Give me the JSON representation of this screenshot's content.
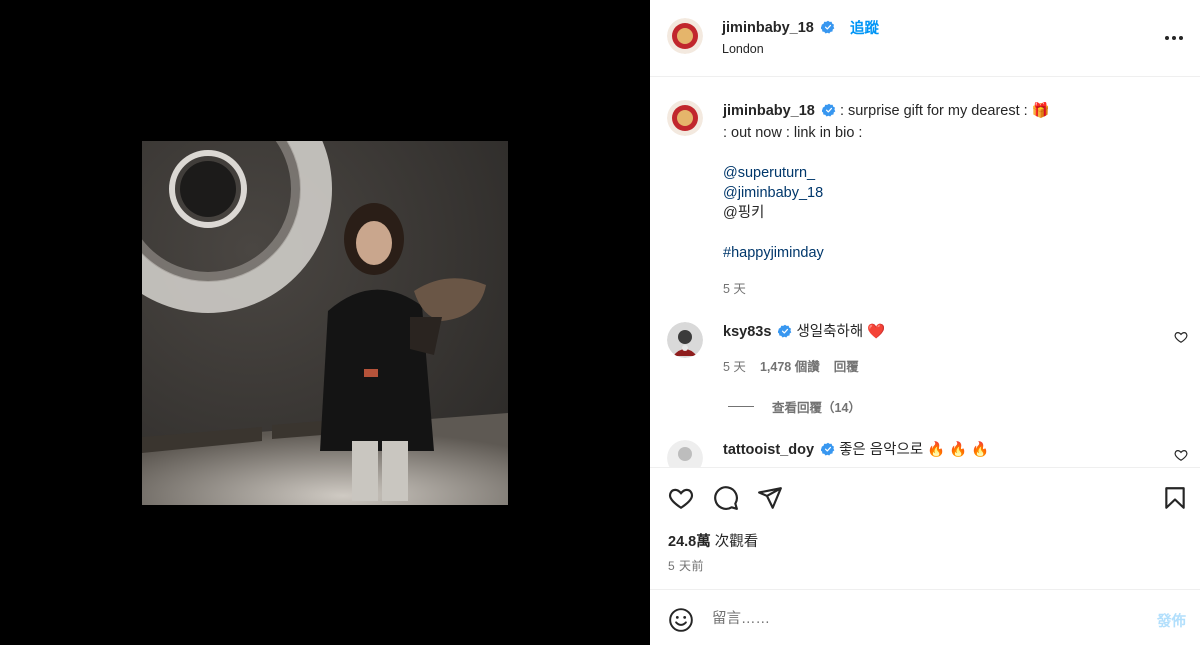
{
  "post": {
    "username": "jiminbaby_18",
    "follow_label": "追蹤",
    "location": "London",
    "caption_lines": [
      ": surprise gift for my dearest : 🎁",
      ": out now : link in bio :",
      "",
      "@superuturn_",
      "@jiminbaby_18",
      "@핑키",
      "",
      "#happyjiminday"
    ],
    "caption_time": "5 天"
  },
  "comments": [
    {
      "username": "ksy83s",
      "text": "생일축하해",
      "emoji": "❤️",
      "time": "5 天",
      "likes": "1,478 個讚",
      "reply_label": "回覆",
      "view_replies": "查看回覆（14）"
    },
    {
      "username": "tattooist_doy",
      "text": "좋은 음악으로",
      "emoji": "🔥 🔥 🔥"
    }
  ],
  "stats": {
    "views_count": "24.8萬",
    "views_label": "次觀看",
    "time": "5 天前"
  },
  "composer": {
    "placeholder": "留言……",
    "post_label": "發佈"
  },
  "icons": {
    "like": "heart-icon",
    "comment": "comment-icon",
    "share": "share-icon",
    "save": "bookmark-icon",
    "emoji": "emoji-icon",
    "more": "more-icon",
    "verified": "verified-badge-icon"
  },
  "colors": {
    "accent": "#0095f6",
    "verified": "#3897f0",
    "link": "#00376b",
    "heart": "#ed1c24"
  }
}
